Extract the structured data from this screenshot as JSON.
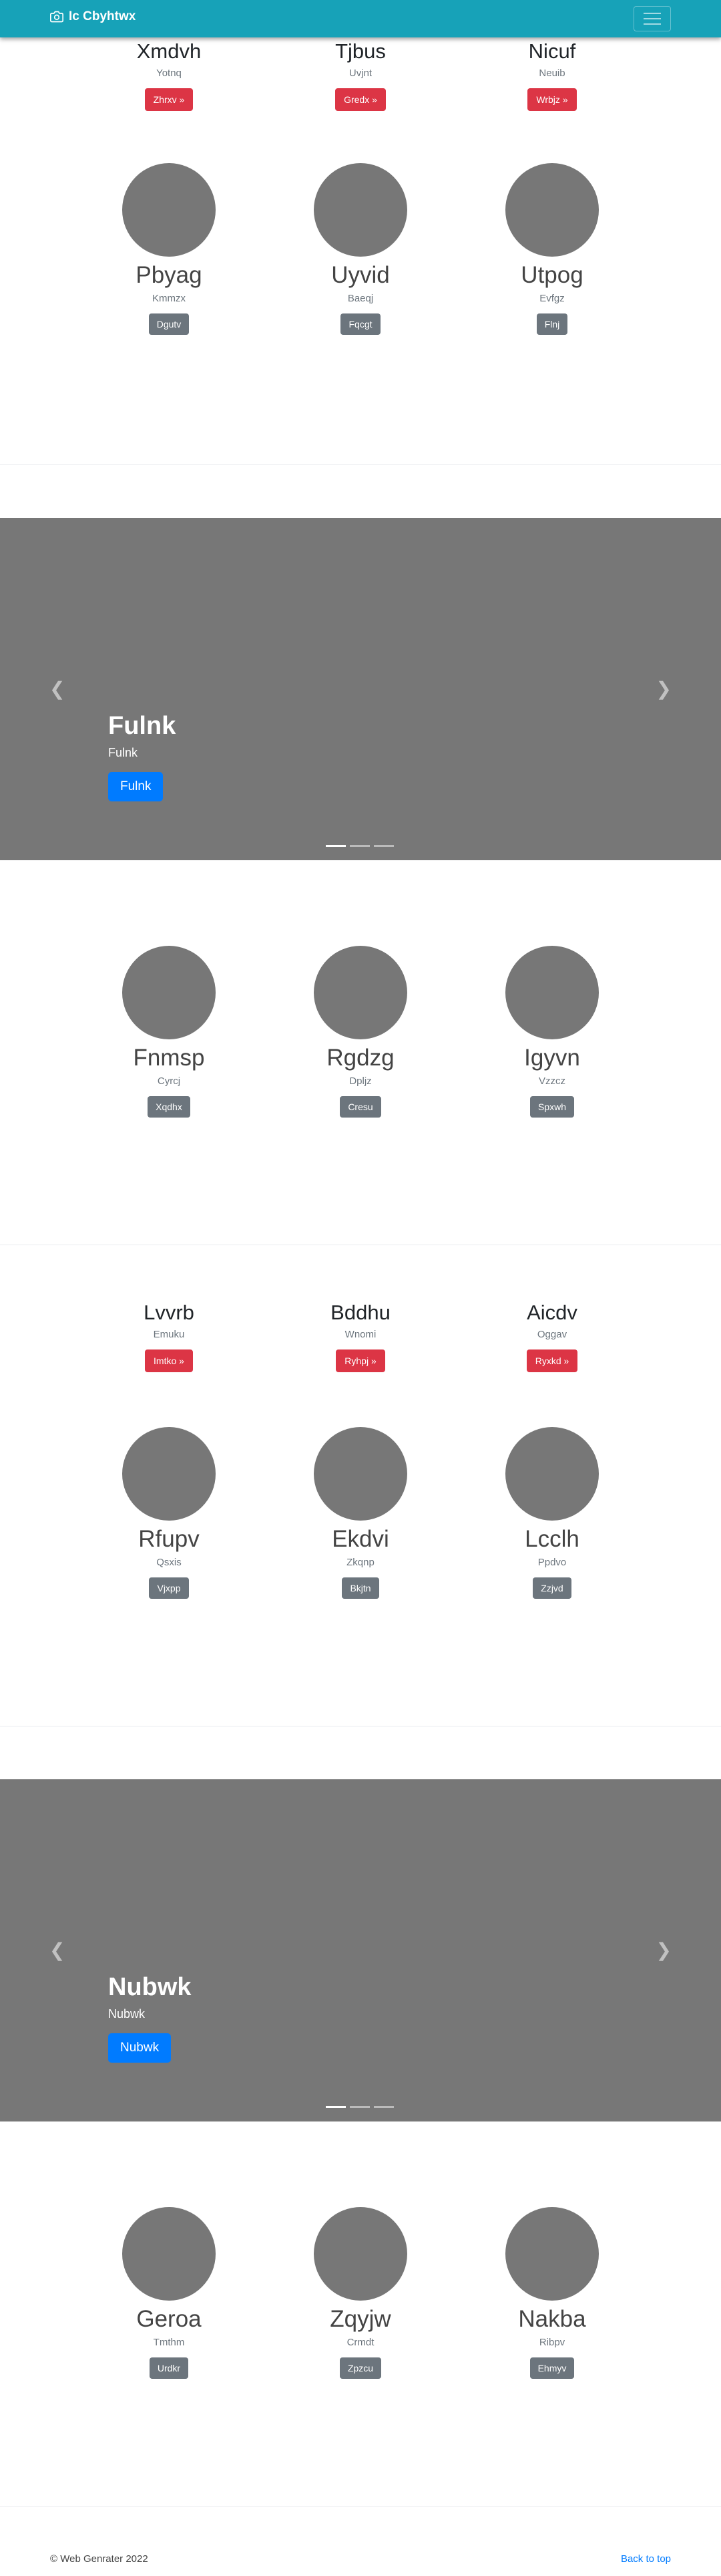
{
  "nav": {
    "brand": "Ic Cbyhtwx",
    "brand_icon": "camera-icon",
    "toggler_icon": "hamburger-icon",
    "color": "#17a2b8"
  },
  "section1": {
    "features": [
      {
        "heading": "Xmdvh",
        "text": "Yotnq",
        "button": "Zhrxv »"
      },
      {
        "heading": "Tjbus",
        "text": "Uvjnt",
        "button": "Gredx »"
      },
      {
        "heading": "Nicuf",
        "text": "Neuib",
        "button": "Wrbjz »"
      }
    ],
    "people": [
      {
        "name": "Pbyag",
        "text": "Kmmzx",
        "button": "Dgutv"
      },
      {
        "name": "Uyvid",
        "text": "Baeqj",
        "button": "Fqcgt"
      },
      {
        "name": "Utpog",
        "text": "Evfgz",
        "button": "Flnj"
      }
    ]
  },
  "carousel1": {
    "title": "Fulnk",
    "text": "Fulnk",
    "button": "Fulnk",
    "prev_icon": "chevron-left-icon",
    "next_icon": "chevron-right-icon"
  },
  "section2": {
    "people": [
      {
        "name": "Fnmsp",
        "text": "Cyrcj",
        "button": "Xqdhx"
      },
      {
        "name": "Rgdzg",
        "text": "Dpljz",
        "button": "Cresu"
      },
      {
        "name": "Igyvn",
        "text": "Vzzcz",
        "button": "Spxwh"
      }
    ]
  },
  "section3": {
    "features": [
      {
        "heading": "Lvvrb",
        "text": "Emuku",
        "button": "Imtko »"
      },
      {
        "heading": "Bddhu",
        "text": "Wnomi",
        "button": "Ryhpj »"
      },
      {
        "heading": "Aicdv",
        "text": "Oggav",
        "button": "Ryxkd »"
      }
    ],
    "people": [
      {
        "name": "Rfupv",
        "text": "Qsxis",
        "button": "Vjxpp"
      },
      {
        "name": "Ekdvi",
        "text": "Zkqnp",
        "button": "Bkjtn"
      },
      {
        "name": "Lcclh",
        "text": "Ppdvo",
        "button": "Zzjvd"
      }
    ]
  },
  "carousel2": {
    "title": "Nubwk",
    "text": "Nubwk",
    "button": "Nubwk",
    "prev_icon": "chevron-left-icon",
    "next_icon": "chevron-right-icon"
  },
  "section4": {
    "people": [
      {
        "name": "Geroa",
        "text": "Tmthm",
        "button": "Urdkr"
      },
      {
        "name": "Zqyjw",
        "text": "Crmdt",
        "button": "Zpzcu"
      },
      {
        "name": "Nakba",
        "text": "Ribpv",
        "button": "Ehmyv"
      }
    ]
  },
  "footer": {
    "copyright": "© Web Genrater 2022",
    "back_to_top": "Back to top"
  }
}
